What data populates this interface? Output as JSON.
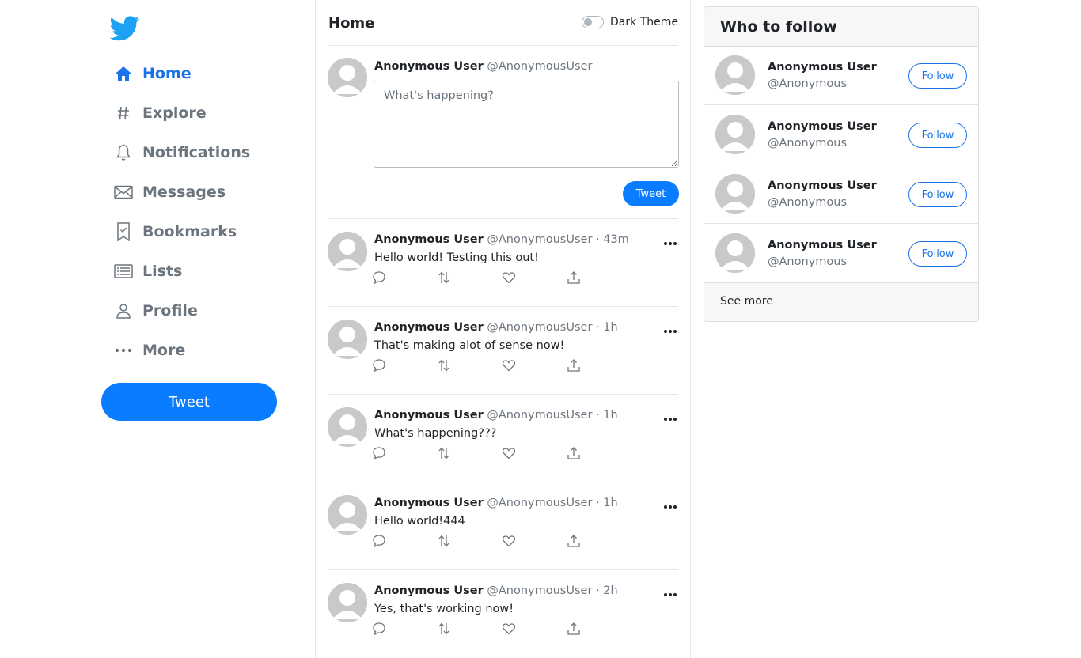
{
  "brand": {
    "logo": "twitter-bird-icon",
    "accent": "#1da1f2",
    "primary_button": "#0a7cff",
    "active_nav": "#1a73e8"
  },
  "sidebar": {
    "items": [
      {
        "label": "Home",
        "icon": "home-icon",
        "active": true
      },
      {
        "label": "Explore",
        "icon": "hash-icon"
      },
      {
        "label": "Notifications",
        "icon": "bell-icon"
      },
      {
        "label": "Messages",
        "icon": "envelope-icon"
      },
      {
        "label": "Bookmarks",
        "icon": "bookmark-icon"
      },
      {
        "label": "Lists",
        "icon": "list-icon"
      },
      {
        "label": "Profile",
        "icon": "user-icon"
      },
      {
        "label": "More",
        "icon": "more-dots-icon"
      }
    ],
    "tweet_button": "Tweet"
  },
  "feed": {
    "title": "Home",
    "theme_toggle": {
      "label": "Dark Theme",
      "on": false
    },
    "composer": {
      "name": "Anonymous User",
      "handle": "@AnonymousUser",
      "placeholder": "What's happening?",
      "value": "",
      "button": "Tweet"
    },
    "tweets": [
      {
        "name": "Anonymous User",
        "handle": "@AnonymousUser",
        "time": " · 43m",
        "text": "Hello world! Testing this out!"
      },
      {
        "name": "Anonymous User",
        "handle": "@AnonymousUser",
        "time": " · 1h",
        "text": "That's making alot of sense now!"
      },
      {
        "name": "Anonymous User",
        "handle": "@AnonymousUser",
        "time": " · 1h",
        "text": "What's happening???"
      },
      {
        "name": "Anonymous User",
        "handle": "@AnonymousUser",
        "time": " · 1h",
        "text": "Hello world!444"
      },
      {
        "name": "Anonymous User",
        "handle": "@AnonymousUser",
        "time": " · 2h",
        "text": "Yes, that's working now!"
      }
    ]
  },
  "who_to_follow": {
    "title": "Who to follow",
    "users": [
      {
        "name": "Anonymous User",
        "handle": "@Anonymous",
        "button": "Follow"
      },
      {
        "name": "Anonymous User",
        "handle": "@Anonymous",
        "button": "Follow"
      },
      {
        "name": "Anonymous User",
        "handle": "@Anonymous",
        "button": "Follow"
      },
      {
        "name": "Anonymous User",
        "handle": "@Anonymous",
        "button": "Follow"
      }
    ],
    "see_more": "See more"
  }
}
